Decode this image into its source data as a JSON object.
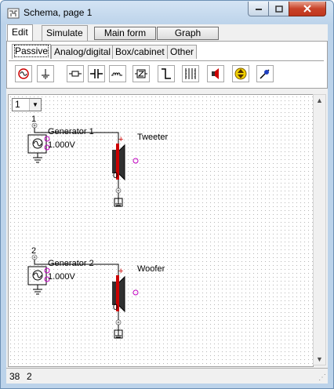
{
  "window": {
    "title": "Schema, page 1",
    "controls": {
      "minimize": "minimize-icon",
      "maximize": "maximize-icon",
      "close": "close-icon"
    }
  },
  "main_tabs": [
    {
      "label": "Edit",
      "active": true
    },
    {
      "label": "Simulate",
      "active": false
    }
  ],
  "buttons": {
    "main_form": "Main form",
    "graph": "Graph"
  },
  "sub_tabs": [
    {
      "label": "Passive",
      "active": true
    },
    {
      "label": "Analog/digital",
      "active": false
    },
    {
      "label": "Box/cabinet",
      "active": false
    },
    {
      "label": "Other",
      "active": false
    }
  ],
  "tools": [
    "generator-icon",
    "ground-icon",
    "resistor-icon",
    "capacitor-icon",
    "inductor-icon",
    "impedance-icon",
    "switch-icon",
    "transformer-icon",
    "speaker-icon",
    "polarity-icon",
    "probe-icon"
  ],
  "page_selector": {
    "value": "1"
  },
  "schematic": {
    "circuits": [
      {
        "node_top": "1",
        "generator_name": "Generator 1",
        "generator_value": "1.000V",
        "speaker_name": "Tweeter",
        "node_bottom": "0"
      },
      {
        "node_top": "2",
        "generator_name": "Generator 2",
        "generator_value": "1.000V",
        "speaker_name": "Woofer",
        "node_bottom": "0"
      }
    ]
  },
  "status": {
    "x": "38",
    "y": "2"
  }
}
